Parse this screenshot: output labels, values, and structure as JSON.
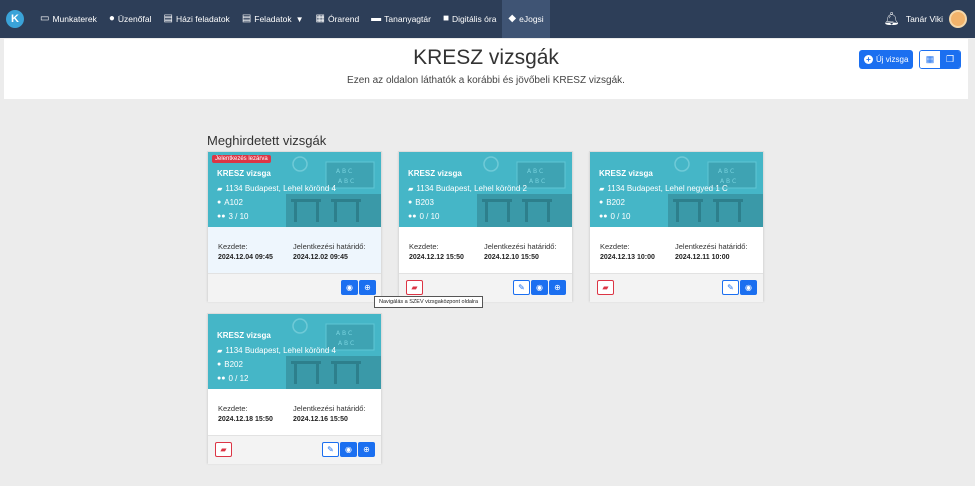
{
  "nav": {
    "logo": "K",
    "items": [
      {
        "label": "Munkaterek",
        "icon": "laptop-icon",
        "glyph": "▭"
      },
      {
        "label": "Üzenőfal",
        "icon": "chat-icon",
        "glyph": "●"
      },
      {
        "label": "Házi feladatok",
        "icon": "document-icon",
        "glyph": "▤"
      },
      {
        "label": "Feladatok",
        "icon": "clipboard-icon",
        "glyph": "▤",
        "dropdown": true
      },
      {
        "label": "Órarend",
        "icon": "calendar-icon",
        "glyph": "▦"
      },
      {
        "label": "Tananyagtár",
        "icon": "book-icon",
        "glyph": "▬"
      },
      {
        "label": "Digitális óra",
        "icon": "video-icon",
        "glyph": "■"
      },
      {
        "label": "eJogsi",
        "icon": "car-icon",
        "glyph": "◆",
        "active": true
      }
    ],
    "user": "Tanár Viki"
  },
  "header": {
    "title": "KRESZ vizsgák",
    "subtitle": "Ezen az oldalon láthatók a korábbi és jövőbeli KRESZ vizsgák.",
    "new_button": "Új vizsga"
  },
  "section": {
    "title": "Meghirdetett vizsgák"
  },
  "labels": {
    "start": "Kezdete:",
    "deadline": "Jelentkezési határidő:"
  },
  "cards": [
    {
      "badge": "Jelentkezés lezárva",
      "title": "KRESZ vizsga",
      "address": "1134 Budapest, Lehel körönd 4",
      "room": "A102",
      "count": "3 / 10",
      "start": "2024.12.04 09:45",
      "deadline": "2024.12.02 09:45"
    },
    {
      "title": "KRESZ vizsga",
      "address": "1134 Budapest, Lehel körönd 2",
      "room": "B203",
      "count": "0 / 10",
      "start": "2024.12.12 15:50",
      "deadline": "2024.12.10 15:50"
    },
    {
      "title": "KRESZ vizsga",
      "address": "1134 Budapest, Lehel negyed 1 C",
      "room": "B202",
      "count": "0 / 10",
      "start": "2024.12.13 10:00",
      "deadline": "2024.12.11 10:00"
    },
    {
      "title": "KRESZ vizsga",
      "address": "1134 Budapest, Lehel körönd 4",
      "room": "B202",
      "count": "0 / 12",
      "start": "2024.12.18 15:50",
      "deadline": "2024.12.16 15:50"
    }
  ],
  "tooltip": "Navigálás a SZEV vizsgaközpont oldalra",
  "colors": {
    "navbar": "#2d3e58",
    "card_header": "#45b6c7",
    "primary": "#1b6ff0",
    "danger": "#dc3545"
  }
}
